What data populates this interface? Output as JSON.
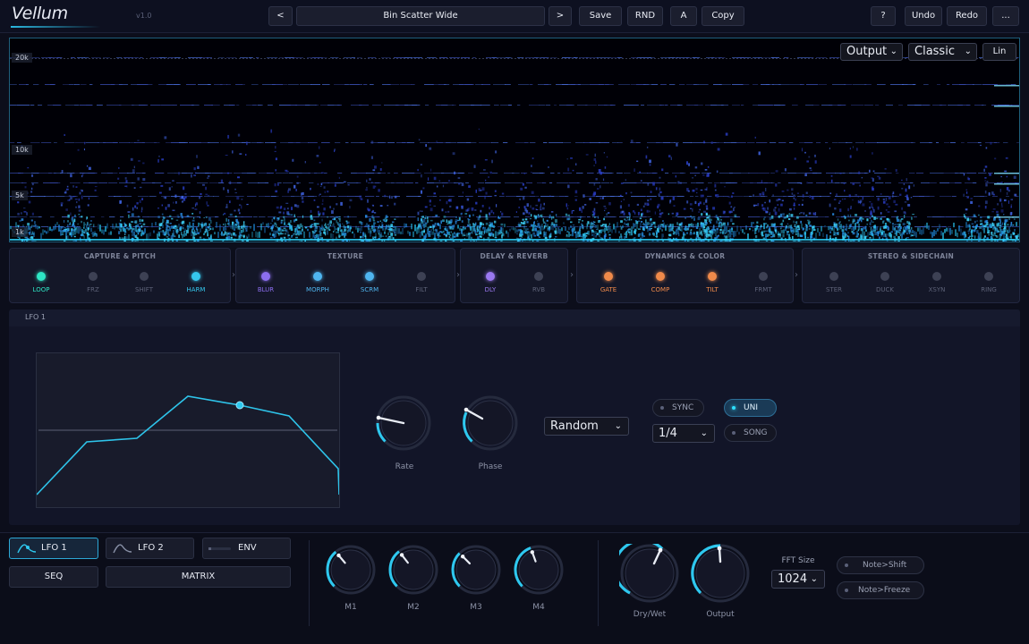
{
  "header": {
    "app_name": "Vellum",
    "version": "v1.0",
    "prev_label": "<",
    "next_label": ">",
    "preset_name": "Bin Scatter Wide",
    "save_label": "Save",
    "rnd_label": "RND",
    "ab_label": "A",
    "copy_label": "Copy",
    "help_label": "?",
    "undo_label": "Undo",
    "redo_label": "Redo",
    "more_label": "..."
  },
  "spectrogram": {
    "freq_labels": [
      "20k",
      "10k",
      "5k",
      "1k"
    ],
    "source_select": "Output",
    "style_select": "Classic",
    "scale_button": "Lin"
  },
  "modules": {
    "groups": [
      {
        "title": "CAPTURE & PITCH",
        "items": [
          {
            "label": "LOOP",
            "active": true,
            "color": "#2ee6c4"
          },
          {
            "label": "FRZ",
            "active": false
          },
          {
            "label": "SHIFT",
            "active": false
          },
          {
            "label": "HARM",
            "active": true,
            "color": "#35c8ee"
          }
        ]
      },
      {
        "title": "TEXTURE",
        "items": [
          {
            "label": "BLUR",
            "active": true,
            "color": "#8c6ef0"
          },
          {
            "label": "MORPH",
            "active": true,
            "color": "#4fb6f0"
          },
          {
            "label": "SCRM",
            "active": true,
            "color": "#4fb6f0"
          },
          {
            "label": "FILT",
            "active": false
          }
        ]
      },
      {
        "title": "DELAY & REVERB",
        "items": [
          {
            "label": "DLY",
            "active": true,
            "color": "#9a78f0"
          },
          {
            "label": "RVB",
            "active": false
          }
        ]
      },
      {
        "title": "DYNAMICS & COLOR",
        "items": [
          {
            "label": "GATE",
            "active": true,
            "color": "#f08a4a"
          },
          {
            "label": "COMP",
            "active": true,
            "color": "#f08a4a"
          },
          {
            "label": "TILT",
            "active": true,
            "color": "#f08a4a"
          },
          {
            "label": "FRMT",
            "active": false
          }
        ]
      },
      {
        "title": "STEREO & SIDECHAIN",
        "items": [
          {
            "label": "STER",
            "active": false
          },
          {
            "label": "DUCK",
            "active": false
          },
          {
            "label": "XSYN",
            "active": false
          },
          {
            "label": "RING",
            "active": false
          }
        ]
      }
    ]
  },
  "lfo": {
    "title": "LFO 1",
    "rate_label": "Rate",
    "phase_label": "Phase",
    "shape": "Random",
    "division": "1/4",
    "sync_label": "SYNC",
    "uni_label": "UNI",
    "song_label": "SONG",
    "sync_on": false,
    "uni_on": true,
    "song_on": false
  },
  "mod_sources": {
    "lfo1": "LFO 1",
    "lfo2": "LFO 2",
    "env": "ENV",
    "seq": "SEQ",
    "matrix": "MATRIX"
  },
  "macros": [
    "M1",
    "M2",
    "M3",
    "M4"
  ],
  "output": {
    "drywet_label": "Dry/Wet",
    "output_label": "Output",
    "fft_label": "FFT Size",
    "fft_value": "1024",
    "note_shift": "Note>Shift",
    "note_freeze": "Note>Freeze"
  },
  "colors": {
    "accent": "#2ec8ef",
    "waveform": "#2ec4ea"
  }
}
